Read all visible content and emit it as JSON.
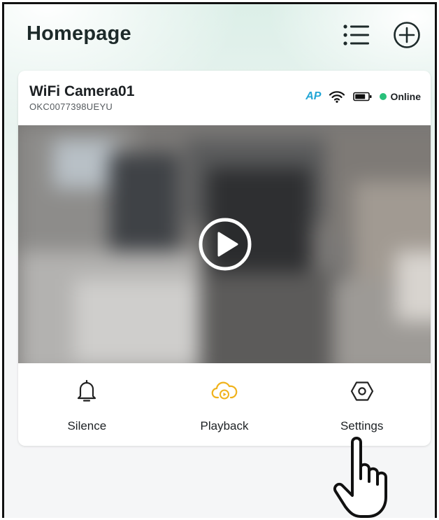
{
  "header": {
    "title": "Homepage",
    "list_icon": "list-icon",
    "add_icon": "plus-circle-icon"
  },
  "camera": {
    "name": "WiFi Camera01",
    "serial": "OKC0077398UEYU",
    "mode_badge": "AP",
    "wifi_icon": "wifi-icon",
    "battery_icon": "battery-icon",
    "status_label": "Online",
    "status_color": "#28c07a",
    "play_icon": "play-icon"
  },
  "actions": [
    {
      "label": "Silence",
      "icon": "bell-icon"
    },
    {
      "label": "Playback",
      "icon": "cloud-playback-icon",
      "color": "#f0b21b"
    },
    {
      "label": "Settings",
      "icon": "hexagon-settings-icon"
    }
  ],
  "overlay": {
    "pointer_icon": "hand-pointer-icon"
  },
  "colors": {
    "accent_blue": "#22a6d6",
    "accent_yellow": "#f0b21b",
    "background_top": "#dcefe8"
  }
}
